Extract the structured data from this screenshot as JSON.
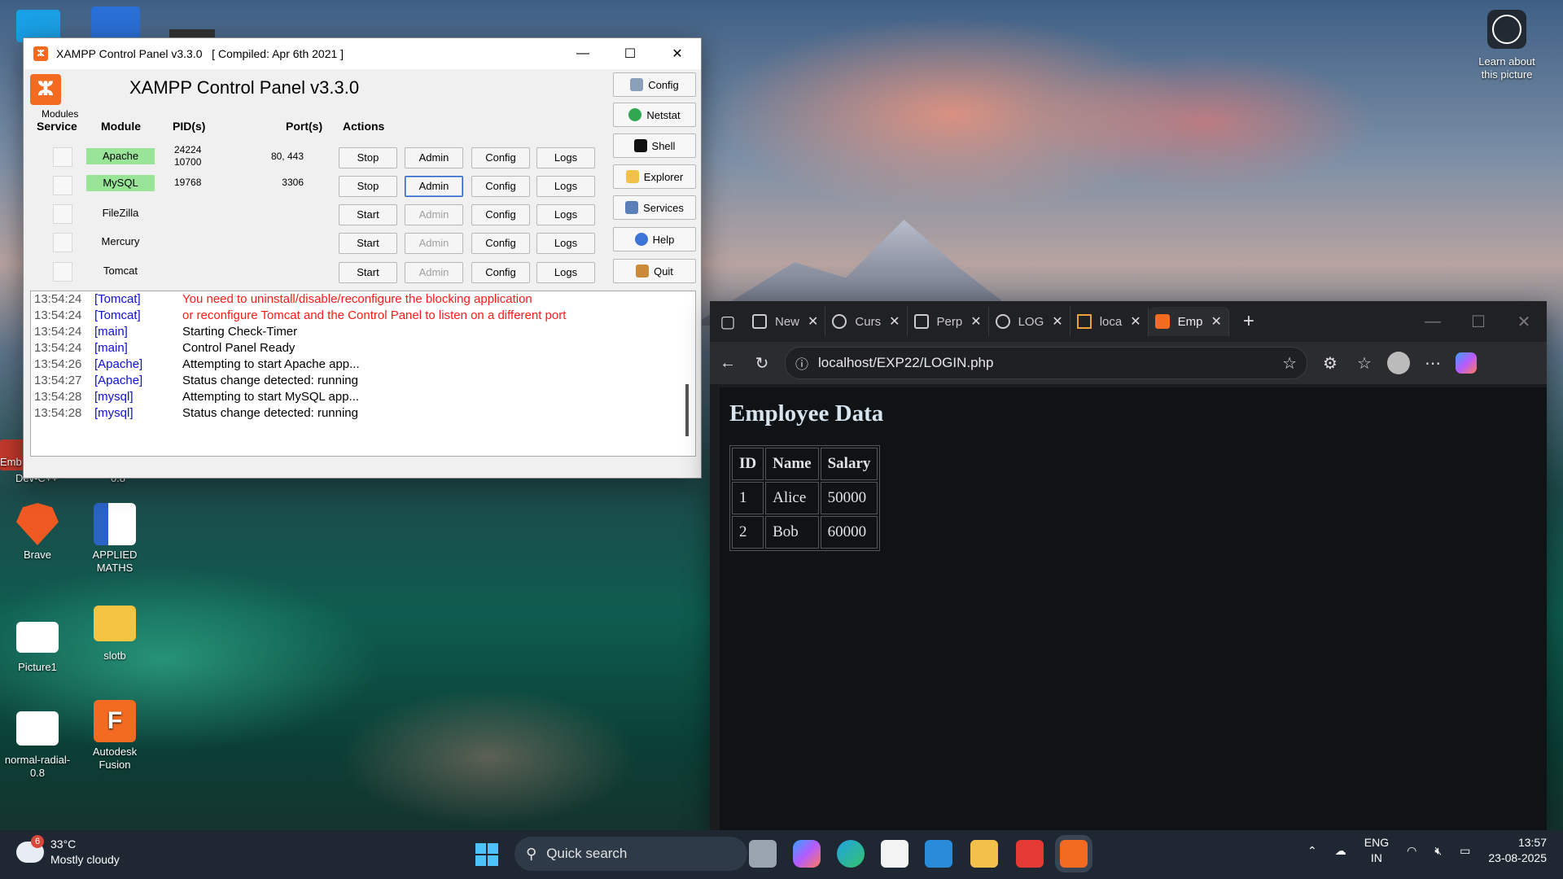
{
  "desktop": {
    "icons": [
      {
        "label": "Brave"
      },
      {
        "label": "APPLIED MATHS"
      },
      {
        "label": "Picture1"
      },
      {
        "label": "slotb"
      },
      {
        "label": "normal-radial-0.8"
      },
      {
        "label": "Autodesk Fusion"
      }
    ],
    "partial_labels": {
      "devcpp": "Dev-C++",
      "emb": "Emb",
      "v08": "0.8"
    },
    "learn": "Learn about this picture"
  },
  "xampp": {
    "window_title": "XAMPP Control Panel v3.3.0   [ Compiled: Apr 6th 2021 ]",
    "heading": "XAMPP Control Panel v3.3.0",
    "modules_label": "Modules",
    "headers": {
      "service": "Service",
      "module": "Module",
      "pids": "PID(s)",
      "ports": "Port(s)",
      "actions": "Actions"
    },
    "rows": [
      {
        "module": "Apache",
        "pid1": "24224",
        "pid2": "10700",
        "ports": "80, 443",
        "action": "Stop",
        "admin": "Admin",
        "config": "Config",
        "logs": "Logs"
      },
      {
        "module": "MySQL",
        "pid1": "19768",
        "pid2": "",
        "ports": "3306",
        "action": "Stop",
        "admin": "Admin",
        "config": "Config",
        "logs": "Logs"
      },
      {
        "module": "FileZilla",
        "pid1": "",
        "pid2": "",
        "ports": "",
        "action": "Start",
        "admin": "Admin",
        "config": "Config",
        "logs": "Logs"
      },
      {
        "module": "Mercury",
        "pid1": "",
        "pid2": "",
        "ports": "",
        "action": "Start",
        "admin": "Admin",
        "config": "Config",
        "logs": "Logs"
      },
      {
        "module": "Tomcat",
        "pid1": "",
        "pid2": "",
        "ports": "",
        "action": "Start",
        "admin": "Admin",
        "config": "Config",
        "logs": "Logs"
      }
    ],
    "side_buttons": [
      "Config",
      "Netstat",
      "Shell",
      "Explorer",
      "Services",
      "Help",
      "Quit"
    ],
    "log": [
      {
        "time": "13:54:24",
        "src": "[Tomcat]",
        "msg": "You need to uninstall/disable/reconfigure the blocking application"
      },
      {
        "time": "13:54:24",
        "src": "[Tomcat]",
        "msg": "or reconfigure Tomcat and the Control Panel to listen on a different port"
      },
      {
        "time": "13:54:24",
        "src": "[main]",
        "msg": "Starting Check-Timer"
      },
      {
        "time": "13:54:24",
        "src": "[main]",
        "msg": "Control Panel Ready"
      },
      {
        "time": "13:54:26",
        "src": "[Apache]",
        "msg": "Attempting to start Apache app..."
      },
      {
        "time": "13:54:27",
        "src": "[Apache]",
        "msg": "Status change detected: running"
      },
      {
        "time": "13:54:28",
        "src": "[mysql]",
        "msg": "Attempting to start MySQL app..."
      },
      {
        "time": "13:54:28",
        "src": "[mysql]",
        "msg": "Status change detected: running"
      }
    ]
  },
  "browser": {
    "tabs": [
      "New",
      "Curs",
      "Perp",
      "LOG",
      "loca",
      "Emp"
    ],
    "url": "localhost/EXP22/LOGIN.php",
    "page_title": "Employee Data",
    "table": {
      "headers": [
        "ID",
        "Name",
        "Salary"
      ],
      "rows": [
        [
          "1",
          "Alice",
          "50000"
        ],
        [
          "2",
          "Bob",
          "60000"
        ]
      ]
    }
  },
  "taskbar": {
    "temp": "33°C",
    "weather": "Mostly cloudy",
    "badge": "6",
    "search": "Quick search",
    "lang1": "ENG",
    "lang2": "IN",
    "time": "13:57",
    "date": "23-08-2025"
  }
}
